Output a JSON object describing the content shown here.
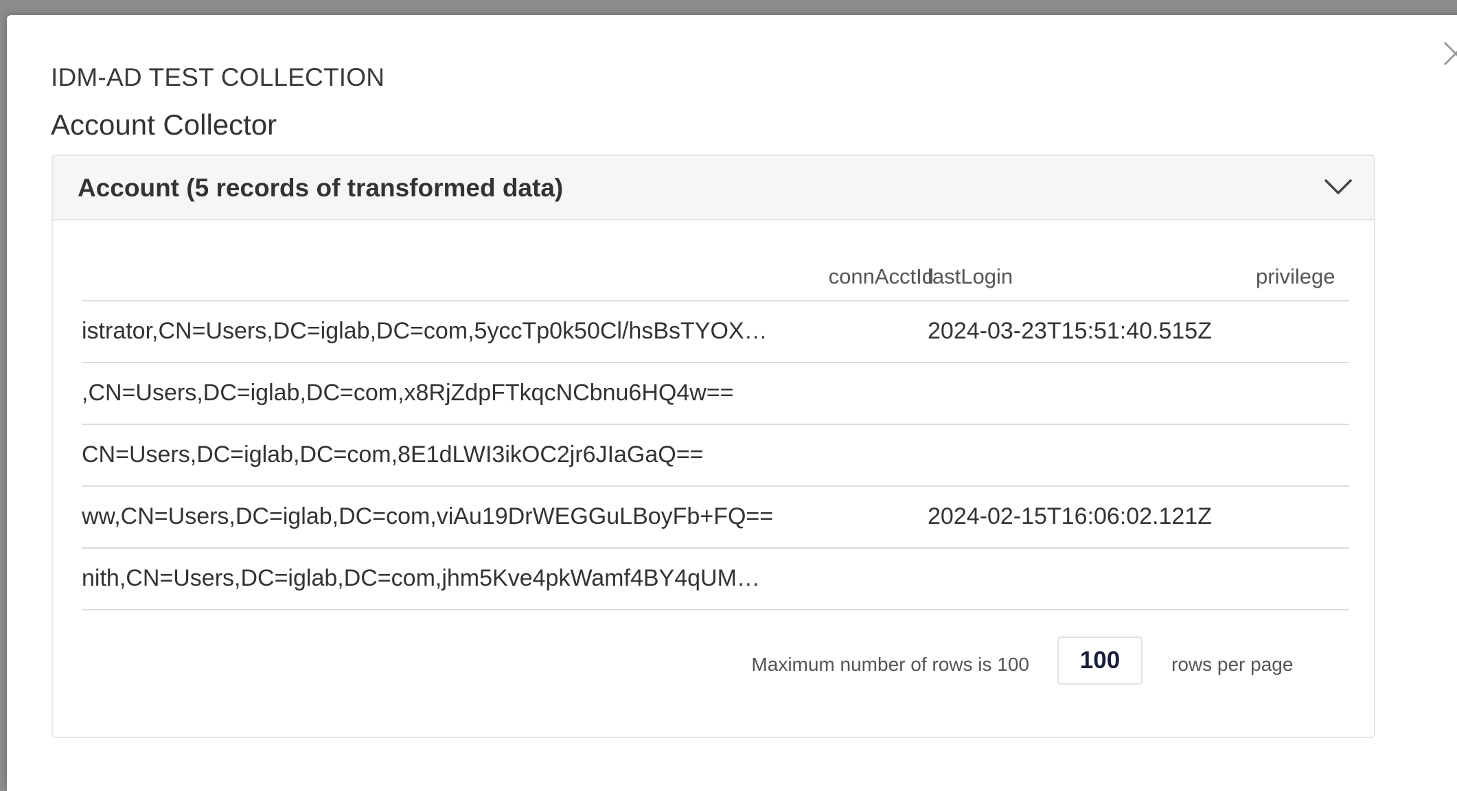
{
  "modal": {
    "collection_name": "IDM-AD TEST COLLECTION",
    "collector_name": "Account Collector"
  },
  "panel": {
    "title": "Account (5 records of transformed data)"
  },
  "table": {
    "columns": [
      "connAcctId",
      "lastLogin",
      "privilege"
    ],
    "rows": [
      {
        "id": "istrator,CN=Users,DC=iglab,DC=com,5yccTp0k50Cl/hsBsTYOX…",
        "last_login": "2024-03-23T15:51:40.515Z"
      },
      {
        "id": ",CN=Users,DC=iglab,DC=com,x8RjZdpFTkqcNCbnu6HQ4w==",
        "last_login": ""
      },
      {
        "id": "CN=Users,DC=iglab,DC=com,8E1dLWI3ikOC2jr6JIaGaQ==",
        "last_login": ""
      },
      {
        "id": "ww,CN=Users,DC=iglab,DC=com,viAu19DrWEGGuLBoyFb+FQ==",
        "last_login": "2024-02-15T16:06:02.121Z"
      },
      {
        "id": "nith,CN=Users,DC=iglab,DC=com,jhm5Kve4pkWamf4BY4qUM…",
        "last_login": ""
      }
    ]
  },
  "pager": {
    "max_rows_text": "Maximum number of rows is 100",
    "rows_value": "100",
    "rows_per_page_label": "rows per page"
  },
  "icons": {
    "close": "close-icon",
    "collapse": "chevron-down-icon"
  },
  "colors": {
    "panel_header_bg": "#f5f6f7",
    "text_primary": "#333333",
    "input_text": "#1b1f3b"
  }
}
